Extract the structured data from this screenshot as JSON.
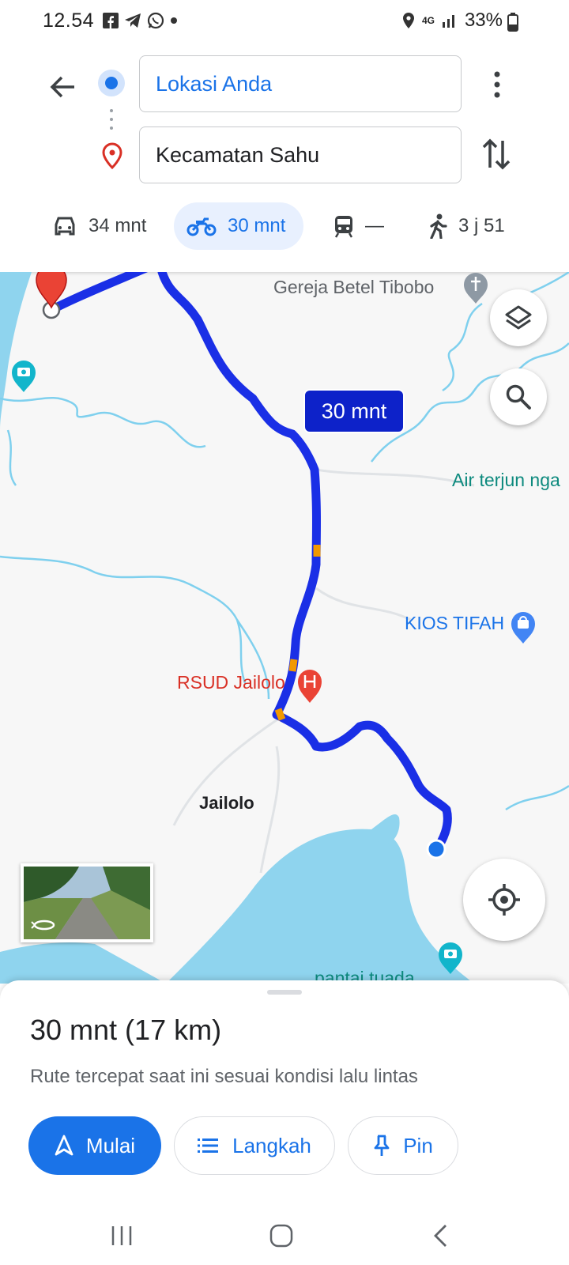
{
  "status_bar": {
    "time": "12.54",
    "network": "4G",
    "battery": "33%"
  },
  "directions": {
    "origin": "Lokasi Anda",
    "destination": "Kecamatan Sahu"
  },
  "travel_modes": [
    {
      "mode": "car",
      "icon": "car-icon",
      "label": "34 mnt",
      "selected": false
    },
    {
      "mode": "motorcycle",
      "icon": "motorcycle-icon",
      "label": "30 mnt",
      "selected": true
    },
    {
      "mode": "transit",
      "icon": "train-icon",
      "label": "—",
      "selected": false
    },
    {
      "mode": "walk",
      "icon": "walking-icon",
      "label": "3 j 51",
      "selected": false
    }
  ],
  "map": {
    "eta_label": "30 mnt",
    "places": {
      "gereja": "Gereja Betel Tibobo",
      "air_terjun": "Air terjun nga",
      "kios": "KIOS TIFAH",
      "rsud": "RSUD Jailolo",
      "jailolo": "Jailolo",
      "pantai": "pantai tuada"
    },
    "colors": {
      "route": "#1a2fe6",
      "route_traffic": "#f29900",
      "water": "#8fd4ee",
      "river": "#7fd0ee"
    }
  },
  "summary": {
    "duration_distance": "30 mnt (17 km)",
    "description": "Rute tercepat saat ini sesuai kondisi lalu lintas"
  },
  "actions": {
    "start": "Mulai",
    "steps": "Langkah",
    "pin": "Pin"
  },
  "accent_color": "#1a73e8"
}
